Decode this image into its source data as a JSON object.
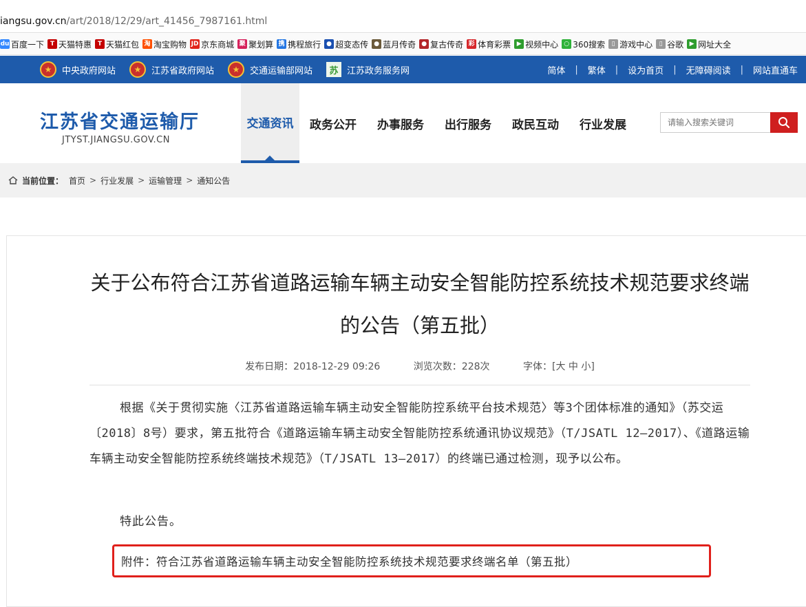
{
  "browser": {
    "url_host": "iangsu.gov.cn",
    "url_path": "/art/2018/12/29/art_41456_7987161.html"
  },
  "bookmarks": [
    {
      "label": "百度一下",
      "icon": "baidu-icon",
      "color": "#3388ff"
    },
    {
      "label": "天猫特惠",
      "icon": "tmall-icon",
      "color": "#c40000"
    },
    {
      "label": "天猫红包",
      "icon": "tmall-icon",
      "color": "#c40000"
    },
    {
      "label": "淘宝购物",
      "icon": "taobao-icon",
      "color": "#ff5000"
    },
    {
      "label": "京东商城",
      "icon": "jd-icon",
      "color": "#e1251b"
    },
    {
      "label": "聚划算",
      "icon": "juhuasuan-icon",
      "color": "#d6215b"
    },
    {
      "label": "携程旅行",
      "icon": "ctrip-icon",
      "color": "#2577e3"
    },
    {
      "label": "超变态传",
      "icon": "game-icon",
      "color": "#1a4fb0"
    },
    {
      "label": "蓝月传奇",
      "icon": "game-icon",
      "color": "#6b5a3a"
    },
    {
      "label": "复古传奇",
      "icon": "game-icon",
      "color": "#b3262a"
    },
    {
      "label": "体育彩票",
      "icon": "lottery-icon",
      "color": "#d6282c"
    },
    {
      "label": "视频中心",
      "icon": "video-icon",
      "color": "#2e9d2e"
    },
    {
      "label": "360搜索",
      "icon": "search-360-icon",
      "color": "#2fb23a"
    },
    {
      "label": "游戏中心",
      "icon": "page-icon",
      "color": "#999999"
    },
    {
      "label": "谷歌",
      "icon": "page-icon",
      "color": "#999999"
    },
    {
      "label": "网址大全",
      "icon": "nav-site-icon",
      "color": "#2e9d2e"
    }
  ],
  "topbar": {
    "links": [
      {
        "label": "中央政府网站",
        "icon": "national-emblem-icon"
      },
      {
        "label": "江苏省政府网站",
        "icon": "national-emblem-icon"
      },
      {
        "label": "交通运输部网站",
        "icon": "national-emblem-icon"
      },
      {
        "label": "江苏政务服务网",
        "icon": "jiangsu-service-icon"
      }
    ],
    "right_links": [
      "简体",
      "繁体",
      "设为首页",
      "无障碍阅读",
      "网站直通车"
    ],
    "separator": "|",
    "bg_color": "#1e5bab"
  },
  "header": {
    "site_name": "江苏省交通运输厅",
    "site_domain": "JTYST.JIANGSU.GOV.CN",
    "nav": [
      "交通资讯",
      "政务公开",
      "办事服务",
      "出行服务",
      "政民互动",
      "行业发展"
    ],
    "active_nav": "交通资讯",
    "search_placeholder": "请输入搜索关键词",
    "accent_color": "#1e5bab",
    "search_button_color": "#cf1f1f"
  },
  "breadcrumb": {
    "label": "当前位置：",
    "items": [
      "首页",
      "行业发展",
      "运输管理",
      "通知公告"
    ],
    "separator": ">"
  },
  "article": {
    "title": "关于公布符合江苏省道路运输车辆主动安全智能防控系统技术规范要求终端的公告（第五批）",
    "publish_date": "发布日期：2018-12-29 09:26",
    "views": "浏览次数：228次",
    "font_size_label": "字体：[大 中 小]",
    "body": "根据《关于贯彻实施〈江苏省道路运输车辆主动安全智能防控系统平台技术规范〉等3个团体标准的通知》（苏交运〔2018〕8号）要求，第五批符合《道路运输车辆主动安全智能防控系统通讯协议规范》（T/JSATL 12—2017）、《道路运输车辆主动安全智能防控系统终端技术规范》（T/JSATL 13—2017）的终端已通过检测，现予以公布。",
    "statement": "特此公告。",
    "attachment": "附件：符合江苏省道路运输车辆主动安全智能防控系统技术规范要求终端名单（第五批）",
    "highlight_color": "#e0201b"
  }
}
